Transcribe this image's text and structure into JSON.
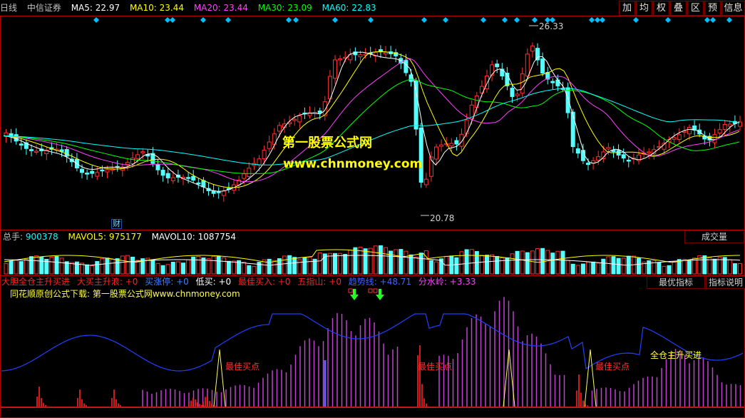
{
  "header": {
    "period": "日线",
    "stock_name": "中信证券",
    "ma": [
      {
        "label": "MA5: 22.97",
        "color": "#ffffff"
      },
      {
        "label": "MA10: 23.44",
        "color": "#ffff00"
      },
      {
        "label": "MA20: 23.44",
        "color": "#ff40ff"
      },
      {
        "label": "MA30: 23.09",
        "color": "#00ff00"
      },
      {
        "label": "MA60: 22.83",
        "color": "#00ffff"
      }
    ]
  },
  "toolbar": [
    "加",
    "均",
    "权",
    "叠",
    "区",
    "预",
    "信息"
  ],
  "price_labels": {
    "high": "26.33",
    "low": "20.78"
  },
  "finance_tag": "财",
  "watermark": {
    "line1": "第一股票公式网",
    "line2": "www.chnmoney.com"
  },
  "volume": {
    "total_label": "总手: ",
    "total_value": "900378",
    "mavol5_label": "MAVOL5: ",
    "mavol5_value": "975177",
    "mavol10_label": "MAVOL10: ",
    "mavol10_value": "1087754",
    "tab": "成交量"
  },
  "indicator": {
    "items": [
      {
        "text": "大胆全仓主升买进",
        "color": "#ff2020"
      },
      {
        "text": "大买主升浪: +0",
        "color": "#ff2020"
      },
      {
        "text": "买涨停: +0",
        "color": "#4080ff"
      },
      {
        "text": "低买: +0",
        "color": "#ffffff"
      },
      {
        "text": "最佳买入: +0",
        "color": "#ff2020"
      },
      {
        "text": "五指山: +0",
        "color": "#ff2020"
      },
      {
        "text": "趋势线: +48.71",
        "color": "#4060ff"
      },
      {
        "text": "分水岭: +3.33",
        "color": "#ff40ff"
      }
    ],
    "title": "同花顺原创公式下载: 第一股票公式网www.chnmoney.com",
    "best_buy_labels": [
      "最佳买点",
      "最佳买点",
      "最佳买点"
    ],
    "full_buy_label": "全仓主升买进",
    "buttons": [
      "最优指标",
      "指标说明"
    ]
  },
  "colors": {
    "up": "#ff3030",
    "down": "#54ffff",
    "border": "#b00000"
  }
}
